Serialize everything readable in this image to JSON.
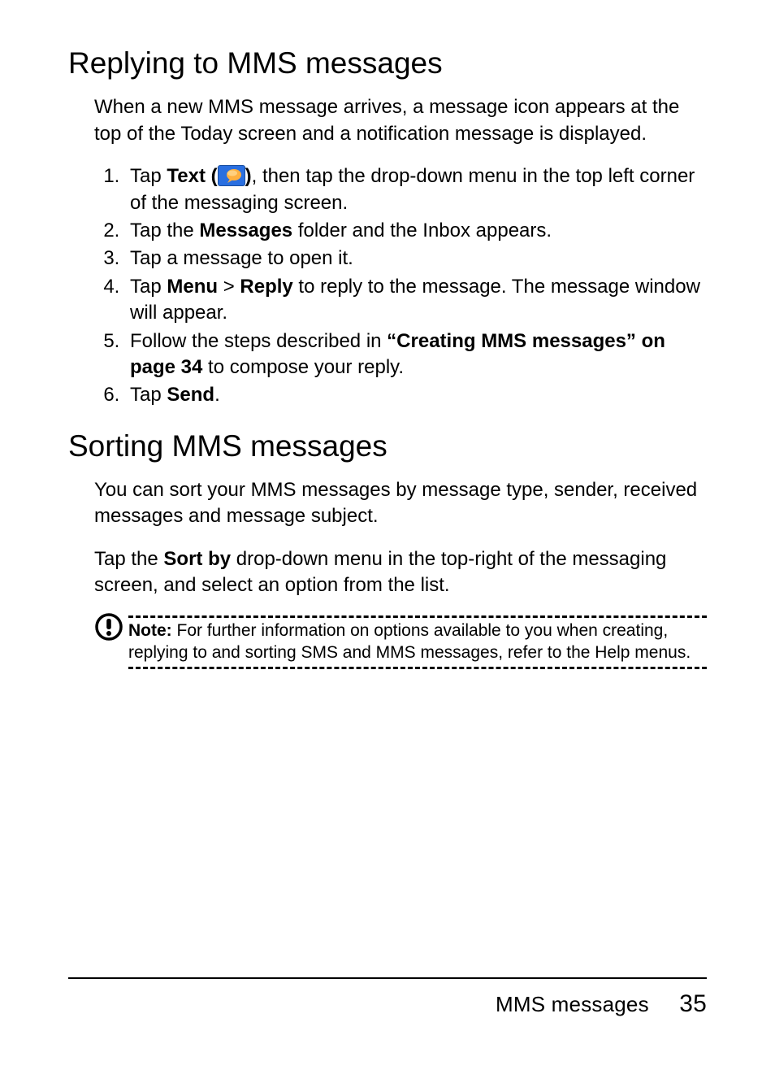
{
  "section1": {
    "heading": "Replying to MMS messages",
    "intro": "When a new MMS message arrives, a message icon appears at the top of the Today screen and a notification message is displayed.",
    "steps": {
      "s1a": "Tap ",
      "s1b": "Text (",
      "s1c": ")",
      "s1d": ", then tap the drop-down menu in the top left corner of the messaging screen.",
      "s2a": "Tap the ",
      "s2b": "Messages",
      "s2c": " folder and the Inbox appears.",
      "s3": "Tap a message to open it.",
      "s4a": "Tap ",
      "s4b": "Menu",
      "s4c": " > ",
      "s4d": "Reply",
      "s4e": " to reply to the message. The message window will appear.",
      "s5a": "Follow the steps described in ",
      "s5b": "“Creating MMS messages” on page 34",
      "s5c": " to compose your reply.",
      "s6a": "Tap ",
      "s6b": "Send",
      "s6c": "."
    }
  },
  "section2": {
    "heading": "Sorting MMS messages",
    "p1": "You can sort your MMS messages by message type, sender, received messages and message subject.",
    "p2a": "Tap the ",
    "p2b": "Sort by",
    "p2c": " drop-down menu in the top-right of the messaging screen, and select an option from the list."
  },
  "note": {
    "label": "Note:",
    "text": " For further information on options available to you when creating, replying to and sorting SMS and MMS messages, refer to the Help menus."
  },
  "footer": {
    "title": "MMS messages",
    "page": "35"
  }
}
